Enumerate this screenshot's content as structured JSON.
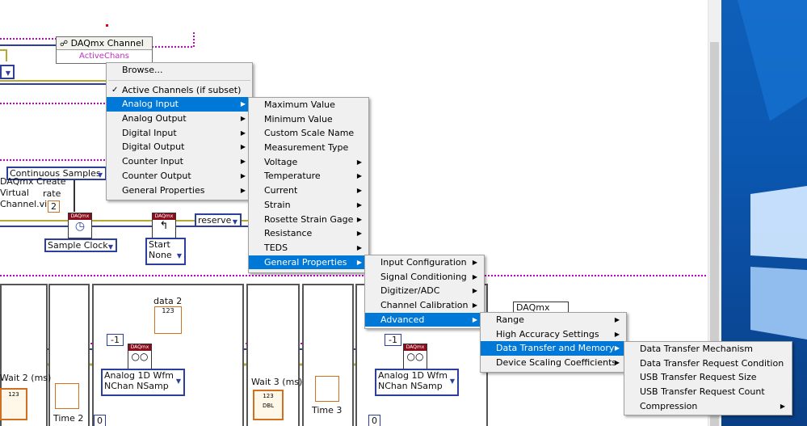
{
  "diagram": {
    "property_node": {
      "title": "DAQmx Channel",
      "item": "ActiveChans"
    },
    "enums": {
      "sample_mode": "Continuous Samples",
      "sample_clock": "Sample Clock",
      "reserve": "reserve",
      "start": "Start",
      "none": "None",
      "read_left": "Analog 1D Wfm",
      "read_left2": "NChan NSamp",
      "read_right": "Analog 1D Wfm",
      "read_right2": "NChan NSamp"
    },
    "labels": {
      "create_vi_1": "DAQmx Create",
      "create_vi_2": "Virtual",
      "create_vi_3": "Channel.vi",
      "rate": "rate",
      "rate_value": "2",
      "data2": "data 2",
      "wait2": "Wait 2 (ms)",
      "wait3": "Wait 3 (ms)",
      "time2": "Time 2",
      "time3": "Time 3",
      "minus1_left": "-1",
      "minus1_right": "-1",
      "daqmx_tag": "DAQmx",
      "daqmx_small": "DAQmx",
      "idx_left": "0",
      "idx_right": "0",
      "indicator_123": "123",
      "dbl": "DBL"
    }
  },
  "menus": {
    "main": {
      "items": [
        {
          "label": "Browse..."
        },
        {
          "label": "Active Channels (if subset)",
          "checked": true
        },
        {
          "label": "Analog Input",
          "submenu": true,
          "selected": true
        },
        {
          "label": "Analog Output",
          "submenu": true
        },
        {
          "label": "Digital Input",
          "submenu": true
        },
        {
          "label": "Digital Output",
          "submenu": true
        },
        {
          "label": "Counter Input",
          "submenu": true
        },
        {
          "label": "Counter Output",
          "submenu": true
        },
        {
          "label": "General Properties",
          "submenu": true
        }
      ]
    },
    "analog_input": {
      "items": [
        {
          "label": "Maximum Value"
        },
        {
          "label": "Minimum Value"
        },
        {
          "label": "Custom Scale Name"
        },
        {
          "label": "Measurement Type"
        },
        {
          "label": "Voltage",
          "submenu": true
        },
        {
          "label": "Temperature",
          "submenu": true
        },
        {
          "label": "Current",
          "submenu": true
        },
        {
          "label": "Strain",
          "submenu": true
        },
        {
          "label": "Rosette Strain Gage",
          "submenu": true
        },
        {
          "label": "Resistance",
          "submenu": true
        },
        {
          "label": "TEDS",
          "submenu": true
        },
        {
          "label": "General Properties",
          "submenu": true,
          "selected": true
        }
      ]
    },
    "general_properties": {
      "items": [
        {
          "label": "Input Configuration",
          "submenu": true
        },
        {
          "label": "Signal Conditioning",
          "submenu": true
        },
        {
          "label": "Digitizer/ADC",
          "submenu": true
        },
        {
          "label": "Channel Calibration",
          "submenu": true
        },
        {
          "label": "Advanced",
          "submenu": true,
          "selected": true
        }
      ]
    },
    "advanced": {
      "items": [
        {
          "label": "Range",
          "submenu": true
        },
        {
          "label": "High Accuracy Settings",
          "submenu": true
        },
        {
          "label": "Data Transfer and Memory",
          "submenu": true,
          "selected": true
        },
        {
          "label": "Device Scaling Coefficients",
          "submenu": true
        }
      ]
    },
    "data_transfer": {
      "items": [
        {
          "label": "Data Transfer Mechanism"
        },
        {
          "label": "Data Transfer Request Condition"
        },
        {
          "label": "USB Transfer Request Size"
        },
        {
          "label": "USB Transfer Request Count"
        },
        {
          "label": "Compression",
          "submenu": true
        }
      ]
    }
  },
  "colors": {
    "menu_bg": "#f0f0f0",
    "menu_highlight": "#0078d7",
    "task_wire": "#2b3f9b",
    "error_wire": "#c8c030",
    "desktop_blue": "#0a58b2"
  }
}
